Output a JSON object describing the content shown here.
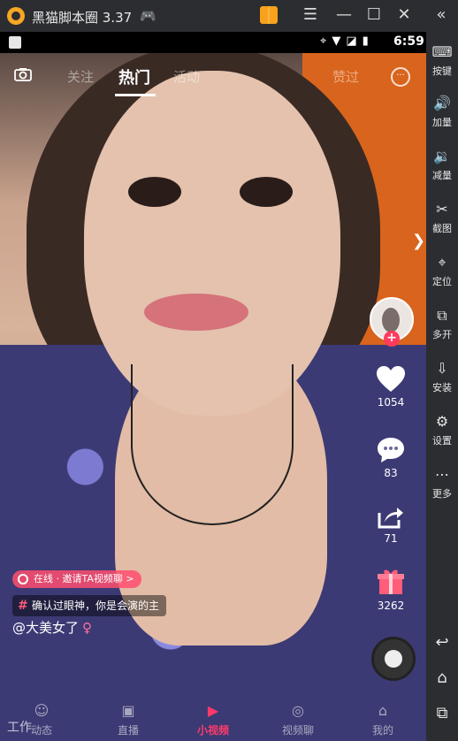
{
  "emulator": {
    "title": "黑猫脚本圈 3.37",
    "sidebar": [
      {
        "label": "按键",
        "icon": "keyboard-icon",
        "glyph": "⌨"
      },
      {
        "label": "加量",
        "icon": "volume-up-icon",
        "glyph": "🔊"
      },
      {
        "label": "减量",
        "icon": "volume-down-icon",
        "glyph": "🔉"
      },
      {
        "label": "截图",
        "icon": "scissors-icon",
        "glyph": "✂"
      },
      {
        "label": "定位",
        "icon": "location-icon",
        "glyph": "⌖"
      },
      {
        "label": "多开",
        "icon": "multi-open-icon",
        "glyph": "⧉"
      },
      {
        "label": "安装",
        "icon": "apk-install-icon",
        "glyph": "⇩"
      },
      {
        "label": "设置",
        "icon": "gear-icon",
        "glyph": "⚙"
      },
      {
        "label": "更多",
        "icon": "more-dots-icon",
        "glyph": "⋯"
      }
    ]
  },
  "status_bar": {
    "time": "6:59"
  },
  "top_tabs": [
    "关注",
    "热门",
    "活动",
    "",
    "",
    "赞过"
  ],
  "active_tab": "热门",
  "actions": {
    "likes": "1054",
    "comments": "83",
    "shares": "71",
    "gifts": "3262"
  },
  "overlay": {
    "online_status": "在线 · 邀请TA视频聊 >",
    "topic": "确认过眼神，你是会演的主",
    "username": "@大美女了",
    "gender_symbol": "♀",
    "partial_text": "工作"
  },
  "bottom_nav": [
    {
      "label": "动态",
      "icon": "moments-icon",
      "glyph": "☺"
    },
    {
      "label": "直播",
      "icon": "live-camera-icon",
      "glyph": "▣"
    },
    {
      "label": "小视频",
      "icon": "play-icon",
      "glyph": "▶"
    },
    {
      "label": "视频聊",
      "icon": "video-chat-icon",
      "glyph": "◎"
    },
    {
      "label": "我的",
      "icon": "home-icon",
      "glyph": "⌂"
    }
  ],
  "active_nav": "小视频",
  "colors": {
    "accent": "#ff3a6a",
    "emulator_bg": "#2b2d31"
  }
}
